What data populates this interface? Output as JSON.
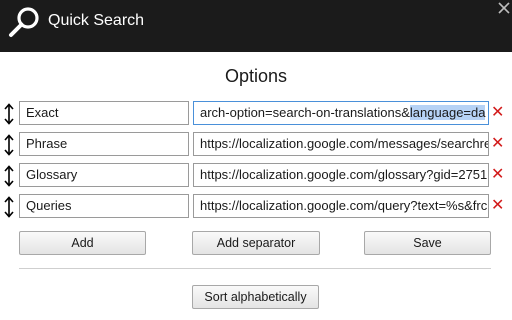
{
  "app": {
    "title": "Quick Search",
    "icons": {
      "logo": "search-icon",
      "close": "close-icon"
    }
  },
  "options": {
    "heading": "Options",
    "rows": [
      {
        "name": "Exact",
        "url_before": "arch-option=search-on-translations&",
        "url_selected": "language=da",
        "focused": true
      },
      {
        "name": "Phrase",
        "url_before": "https://localization.google.com/messages/searchre",
        "url_selected": ""
      },
      {
        "name": "Glossary",
        "url_before": "https://localization.google.com/glossary?gid=2751",
        "url_selected": ""
      },
      {
        "name": "Queries",
        "url_before": "https://localization.google.com/query?text=%s&frc",
        "url_selected": ""
      }
    ],
    "row_icons": {
      "drag": "drag-handle-icon",
      "remove": "remove-icon"
    },
    "remove_glyph": "✕",
    "remove_color": "#d21a1a"
  },
  "buttons": {
    "add": "Add",
    "add_separator": "Add separator",
    "save": "Save",
    "sort": "Sort alphabetically"
  },
  "colors": {
    "titlebar": "#1b1b1b",
    "selection": "#b6d2f5",
    "focus_border": "#4a90d9"
  }
}
